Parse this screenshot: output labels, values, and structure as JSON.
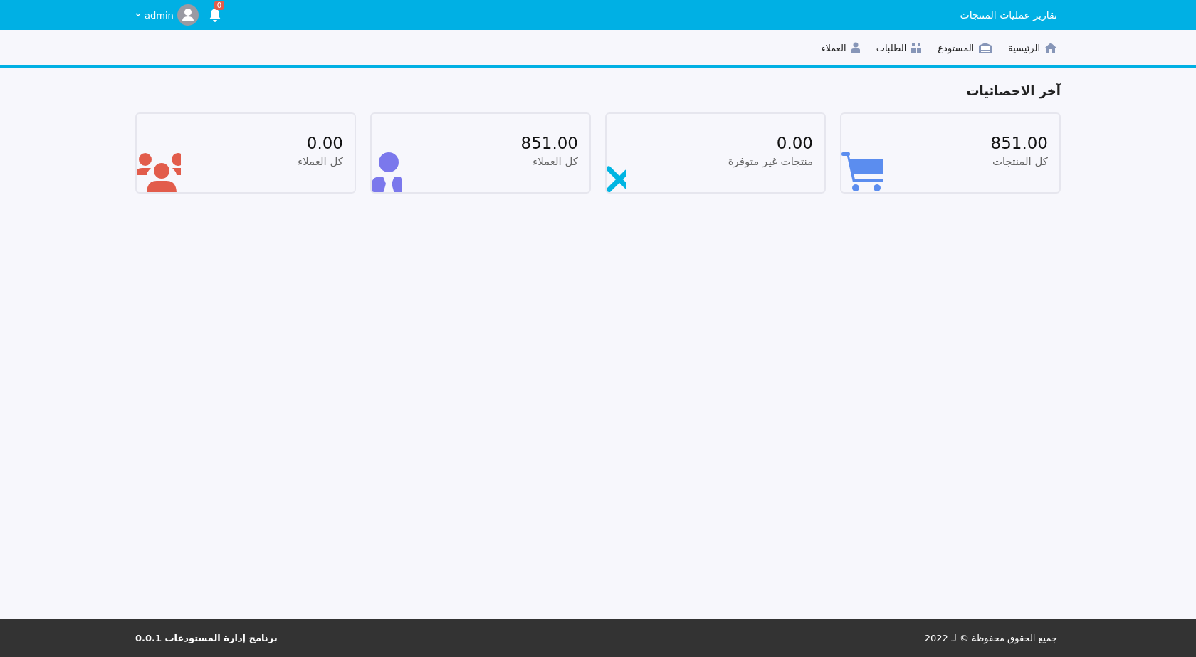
{
  "header": {
    "title": "تقارير عمليات المنتجات",
    "user": "admin",
    "notifications": "0"
  },
  "nav": [
    {
      "label": "الرئيسية",
      "kind": "home"
    },
    {
      "label": "المستودع",
      "kind": "warehouse"
    },
    {
      "label": "الطلبات",
      "kind": "orders"
    },
    {
      "label": "العملاء",
      "kind": "clients"
    }
  ],
  "section_title": "آخر الاحصائيات",
  "stats": [
    {
      "value": "851.00",
      "label": "كل المنتجات",
      "kind": "cart",
      "color": "#5b8def"
    },
    {
      "value": "0.00",
      "label": "منتجات غير متوفرة",
      "kind": "cross",
      "color": "#00b5e2"
    },
    {
      "value": "851.00",
      "label": "كل العملاء",
      "kind": "person",
      "color": "#7b78ec"
    },
    {
      "value": "0.00",
      "label": "كل العملاء",
      "kind": "group",
      "color": "#e25c4b"
    }
  ],
  "footer": {
    "copyright": "جميع الحقوق محفوظة © لـ 2022",
    "version": "برنامج إدارة المستودعات 0.0.1"
  }
}
